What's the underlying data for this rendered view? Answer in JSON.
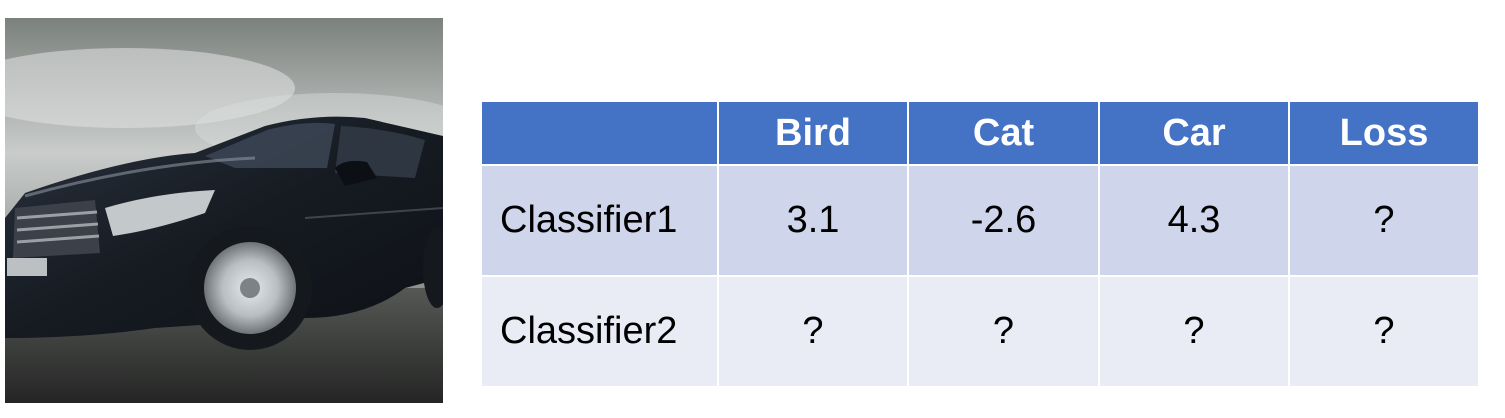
{
  "image": {
    "subject": "car",
    "colors": {
      "sky_light": "#d9dcdc",
      "sky_dark": "#6f7672",
      "road": "#2e2f2e",
      "car_body": "#1c222b",
      "glass": "#2b3440",
      "chrome": "#c8ccd0"
    }
  },
  "table": {
    "colors": {
      "header_bg": "#4472c4",
      "header_text": "#ffffff",
      "row_odd_bg": "#cfd5ea",
      "row_even_bg": "#e9ebf5",
      "border": "#ffffff"
    },
    "corner": "",
    "columns": [
      "Bird",
      "Cat",
      "Car",
      "Loss"
    ],
    "rows": [
      {
        "label": "Classifier1",
        "cells": [
          "3.1",
          "-2.6",
          "4.3",
          "?"
        ]
      },
      {
        "label": "Classifier2",
        "cells": [
          "?",
          "?",
          "?",
          "?"
        ]
      }
    ]
  }
}
